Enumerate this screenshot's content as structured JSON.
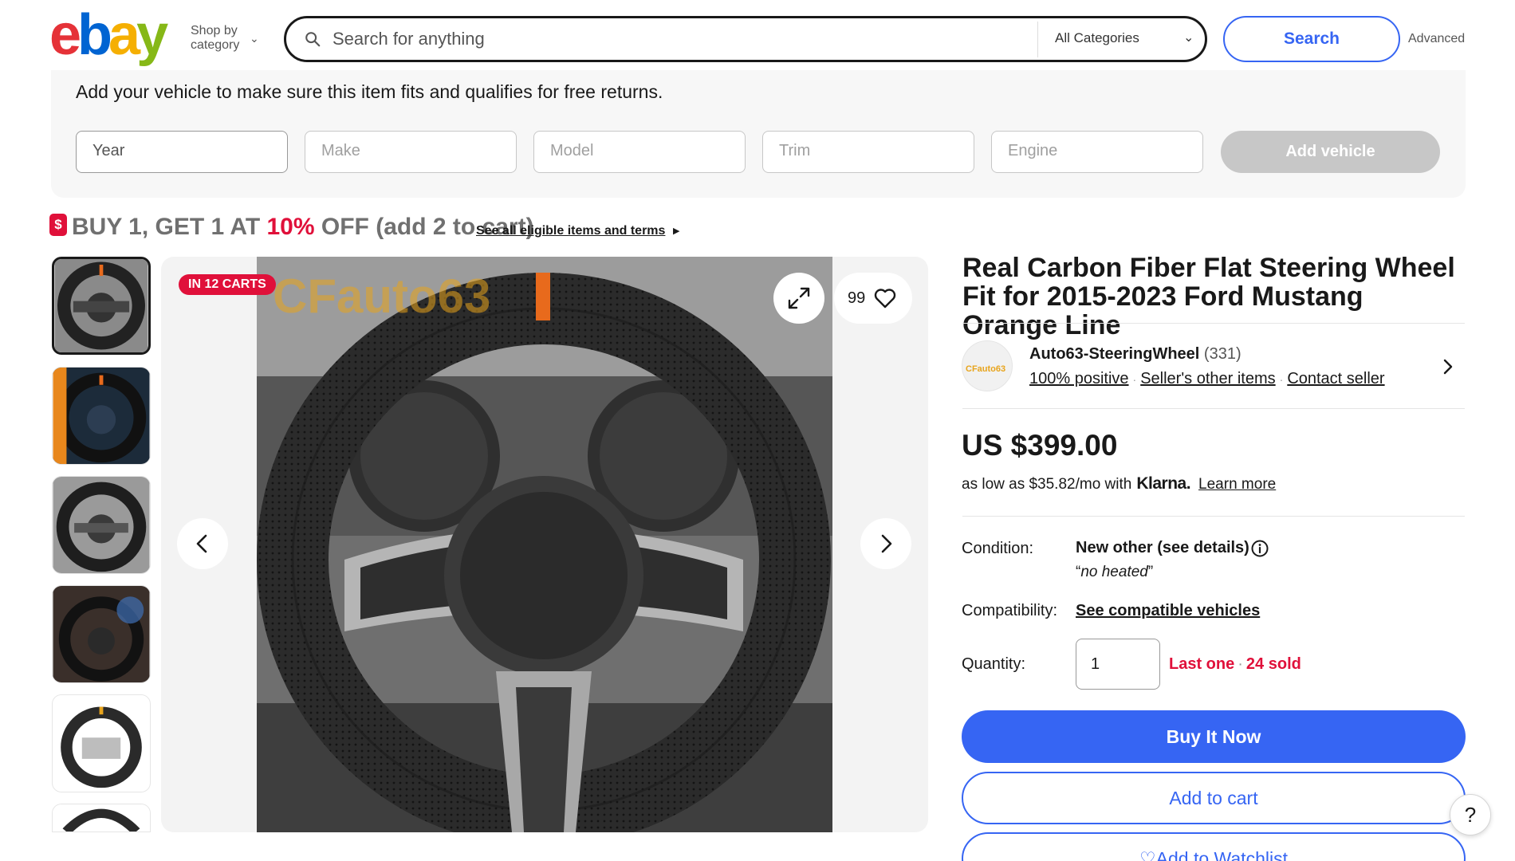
{
  "header": {
    "logo_letters": [
      "e",
      "b",
      "a",
      "y"
    ],
    "shop_by_line1": "Shop by",
    "shop_by_line2": "category",
    "search_placeholder": "Search for anything",
    "category": "All Categories",
    "search_button": "Search",
    "advanced": "Advanced"
  },
  "vehicle": {
    "title": "Add your vehicle to make sure this item fits and qualifies for free returns.",
    "fields": [
      "Year",
      "Make",
      "Model",
      "Trim",
      "Engine"
    ],
    "add_button": "Add vehicle"
  },
  "promo": {
    "icon_glyph": "$",
    "prefix": "BUY 1, GET 1 AT ",
    "highlight": "10%",
    "suffix": " OFF (add 2 to cart)",
    "link": "See all eligible items and terms",
    "accent": "#e0103a"
  },
  "gallery": {
    "badge": "IN 12 CARTS",
    "watch_count": "99",
    "watermark": "CFauto63",
    "icons": [
      "expand-icon",
      "heart-icon",
      "chevron-left-icon",
      "chevron-right-icon"
    ]
  },
  "item": {
    "title": "Real Carbon Fiber Flat Steering Wheel Fit for 2015-2023 Ford Mustang Orange Line",
    "seller": {
      "name": "Auto63-SteeringWheel",
      "count": "(331)",
      "positive": "100% positive",
      "other_items": "Seller's other items",
      "contact": "Contact seller",
      "logo_text": "CFauto63"
    },
    "price": "US $399.00",
    "installment_prefix": "as low as $35.82/mo with",
    "klarna": "Klarna.",
    "learn_more": "Learn more",
    "condition_label": "Condition:",
    "condition_value": "New other (see details)",
    "condition_note_open": "“",
    "condition_note": "no heated",
    "condition_note_close": "”",
    "compat_label": "Compatibility:",
    "compat_link": "See compatible vehicles",
    "quantity_label": "Quantity:",
    "quantity_value": "1",
    "stock_last": "Last one",
    "stock_sold": "24 sold",
    "buy_now": "Buy It Now",
    "add_to_cart": "Add to cart",
    "add_to_watchlist": "Add to Watchlist"
  },
  "help": "?",
  "colors": {
    "brand_blue": "#3665f3",
    "alert_red": "#e0103a",
    "logo_red": "#e53238",
    "logo_blue": "#0064d2",
    "logo_yellow": "#f5af02",
    "logo_green": "#86b817"
  }
}
